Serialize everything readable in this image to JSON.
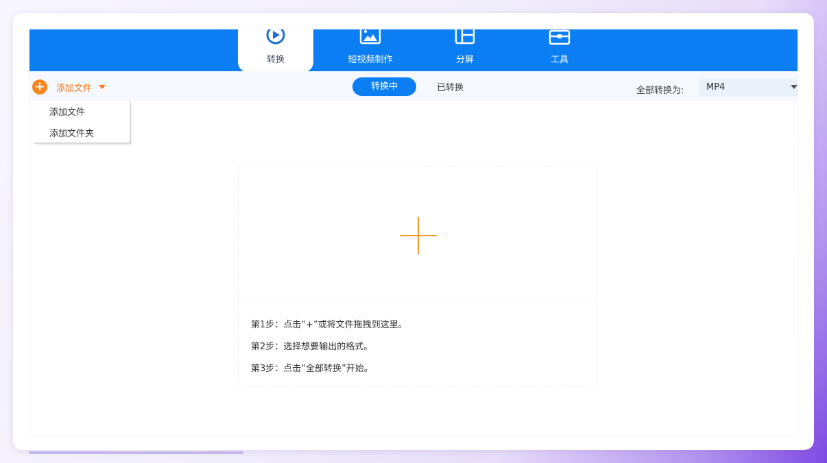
{
  "nav": {
    "tabs": [
      {
        "label": "转换",
        "icon": "convert-play-icon",
        "active": true
      },
      {
        "label": "短视频制作",
        "icon": "image-icon",
        "active": false
      },
      {
        "label": "分屏",
        "icon": "split-screen-icon",
        "active": false
      },
      {
        "label": "工具",
        "icon": "toolbox-icon",
        "active": false
      }
    ]
  },
  "toolbar": {
    "add_file_label": "添加文件",
    "status_tabs": {
      "converting": "转换中",
      "converted": "已转换"
    },
    "convert_all_label": "全部转换为:",
    "format_selected": "MP4"
  },
  "dropdown": {
    "items": [
      "添加文件",
      "添加文件夹"
    ]
  },
  "dropzone": {
    "steps": [
      "第1步：点击“+”或将文件拖拽到这里。",
      "第2步：选择想要输出的格式。",
      "第3步：点击“全部转换”开始。"
    ]
  },
  "colors": {
    "primary": "#0b7ef4",
    "accent": "#f5861f"
  }
}
